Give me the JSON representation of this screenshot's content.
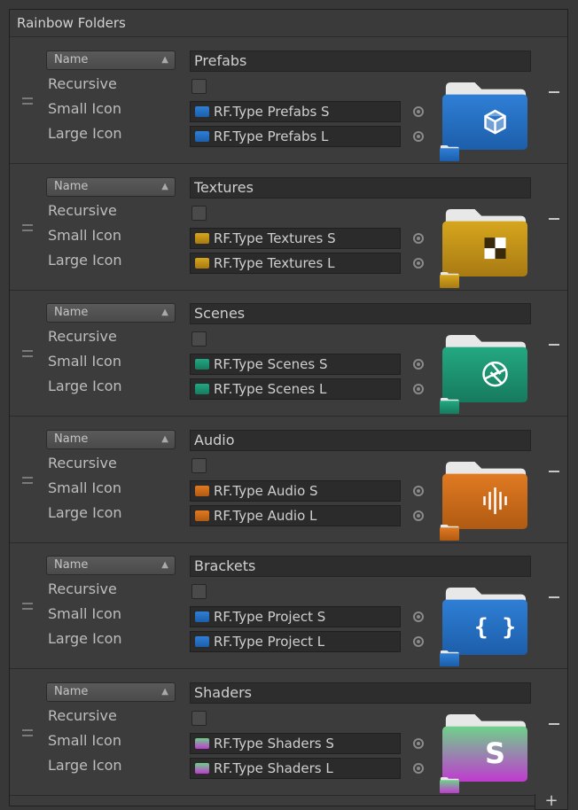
{
  "window": {
    "title": "Rainbow Folders"
  },
  "entries": [
    {
      "mode": "Name",
      "name": "Prefabs",
      "recursive_label": "Recursive",
      "small_label": "Small Icon",
      "large_label": "Large Icon",
      "small_value": "RF.Type Prefabs S",
      "large_value": "RF.Type Prefabs L",
      "color": "#2f7fd6",
      "color_dark": "#1c5eaa",
      "glyph": "cube-icon"
    },
    {
      "mode": "Name",
      "name": "Textures",
      "recursive_label": "Recursive",
      "small_label": "Small Icon",
      "large_label": "Large Icon",
      "small_value": "RF.Type Textures S",
      "large_value": "RF.Type Textures L",
      "color": "#d6a61e",
      "color_dark": "#a87a12",
      "glyph": "checker-icon"
    },
    {
      "mode": "Name",
      "name": "Scenes",
      "recursive_label": "Recursive",
      "small_label": "Small Icon",
      "large_label": "Large Icon",
      "small_value": "RF.Type Scenes S",
      "large_value": "RF.Type Scenes L",
      "color": "#23a882",
      "color_dark": "#167a5e",
      "glyph": "aperture-icon"
    },
    {
      "mode": "Name",
      "name": "Audio",
      "recursive_label": "Recursive",
      "small_label": "Small Icon",
      "large_label": "Large Icon",
      "small_value": "RF.Type Audio S",
      "large_value": "RF.Type Audio L",
      "color": "#e07a22",
      "color_dark": "#b05a12",
      "glyph": "waveform-icon"
    },
    {
      "mode": "Name",
      "name": "Brackets",
      "recursive_label": "Recursive",
      "small_label": "Small Icon",
      "large_label": "Large Icon",
      "small_value": "RF.Type Project S",
      "large_value": "RF.Type Project L",
      "color": "#2f7fd6",
      "color_dark": "#1c5eaa",
      "glyph": "braces-icon"
    },
    {
      "mode": "Name",
      "name": "Shaders",
      "recursive_label": "Recursive",
      "small_label": "Small Icon",
      "large_label": "Large Icon",
      "small_value": "RF.Type Shaders S",
      "large_value": "RF.Type Shaders L",
      "color": "#6fd18a",
      "color_dark": "#c03ad0",
      "glyph": "letter-s-icon"
    }
  ],
  "footer": {
    "add_label": "+"
  }
}
